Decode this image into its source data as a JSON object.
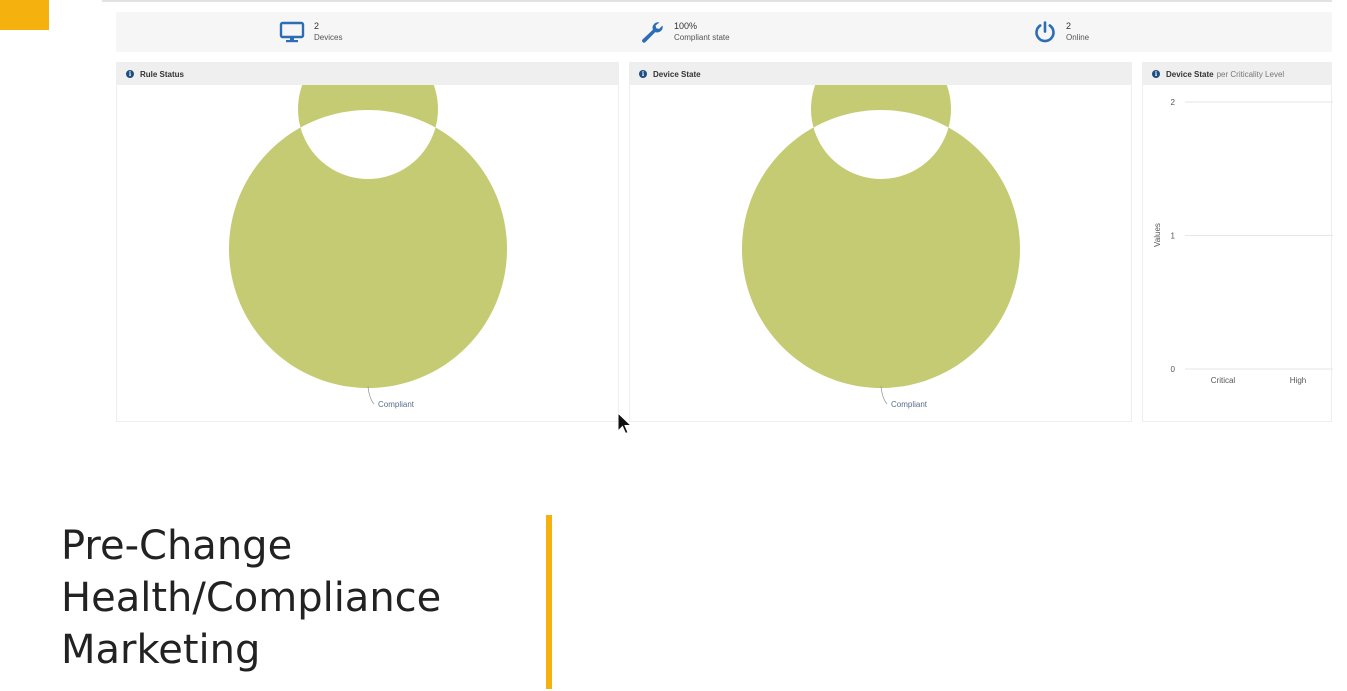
{
  "stats": [
    {
      "icon": "monitor-icon",
      "value": "2",
      "label": "Devices"
    },
    {
      "icon": "wrench-icon",
      "value": "100%",
      "label": "Compliant state"
    },
    {
      "icon": "power-icon",
      "value": "2",
      "label": "Online"
    }
  ],
  "panels": {
    "rule_status": {
      "title": "Rule Status"
    },
    "device_state": {
      "title": "Device State"
    },
    "criticality": {
      "title_bold": "Device State",
      "title_light": "per Criticality Level"
    }
  },
  "slide": {
    "title_lines": [
      "Pre-Change",
      "Health/Compliance",
      "Marketing"
    ]
  },
  "colors": {
    "compliant": "#c5cb73",
    "accent": "#f5b20e",
    "icon_blue": "#2d6db3"
  },
  "chart_data": [
    {
      "type": "pie",
      "title": "Rule Status",
      "slices": [
        {
          "label": "Compliant",
          "value": 100
        }
      ]
    },
    {
      "type": "pie",
      "title": "Device State",
      "slices": [
        {
          "label": "Compliant",
          "value": 100
        }
      ]
    },
    {
      "type": "bar",
      "title": "Device State per Criticality Level",
      "categories": [
        "Critical",
        "High"
      ],
      "series": [],
      "ylabel": "Values",
      "ylim": [
        0,
        2
      ],
      "yticks": [
        0,
        1,
        2
      ],
      "grid": true
    }
  ]
}
